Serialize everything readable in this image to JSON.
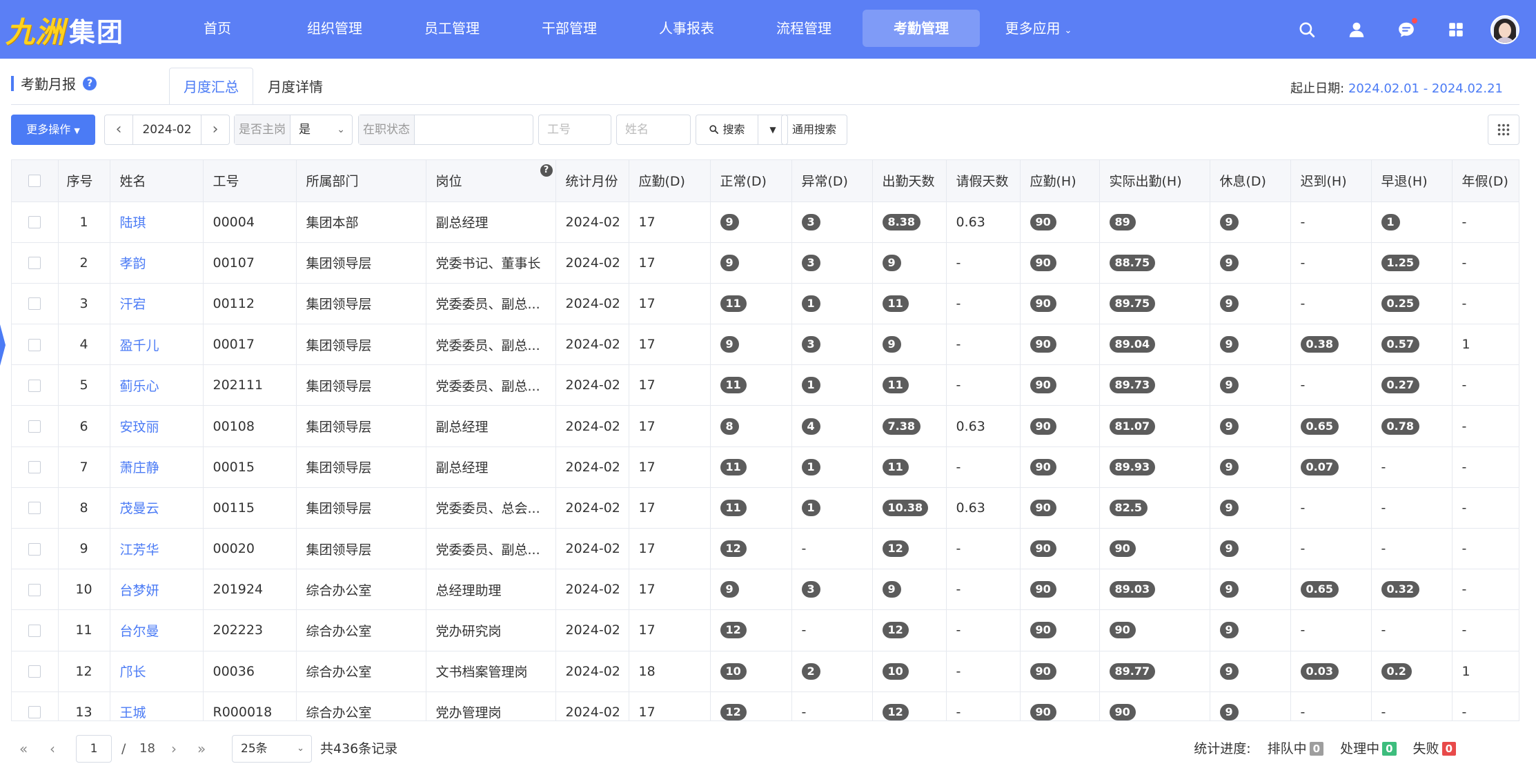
{
  "logo": {
    "part1": "九洲",
    "part2": "集团"
  },
  "nav": {
    "items": [
      {
        "label": "首页"
      },
      {
        "label": "组织管理"
      },
      {
        "label": "员工管理"
      },
      {
        "label": "干部管理"
      },
      {
        "label": "人事报表"
      },
      {
        "label": "流程管理"
      },
      {
        "label": "考勤管理"
      },
      {
        "label": "更多应用"
      }
    ],
    "active": "考勤管理",
    "more_caret": "⌄"
  },
  "header_icons": [
    "search-icon",
    "user-icon",
    "message-icon",
    "apps-icon",
    "avatar"
  ],
  "page": {
    "title": "考勤月报",
    "help": "?"
  },
  "tabs": [
    {
      "label": "月度汇总"
    },
    {
      "label": "月度详情"
    }
  ],
  "date_range": {
    "label": "起止日期:",
    "value": "2024.02.01 - 2024.02.21"
  },
  "toolbar": {
    "more_ops": "更多操作",
    "month": "2024-02",
    "is_main_post": {
      "label": "是否主岗",
      "value": "是"
    },
    "employment_status": {
      "label": "在职状态",
      "value": ""
    },
    "employee_no_placeholder": "工号",
    "name_placeholder": "姓名",
    "search_label": "搜索",
    "general_search_label": "通用搜索"
  },
  "table": {
    "columns": [
      "序号",
      "姓名",
      "工号",
      "所属部门",
      "岗位",
      "统计月份",
      "应勤(D)",
      "正常(D)",
      "异常(D)",
      "出勤天数",
      "请假天数",
      "应勤(H)",
      "实际出勤(H)",
      "休息(D)",
      "迟到(H)",
      "早退(H)",
      "年假(D)"
    ],
    "rows": [
      {
        "no": "1",
        "name": "陆琪",
        "emp_no": "00004",
        "dept": "集团本部",
        "post": "副总经理",
        "month": "2024-02",
        "due_d": "17",
        "normal_d": "9",
        "abnormal_d": "3",
        "attend_days": "8.38",
        "leave_days": "0.63",
        "due_h": "90",
        "actual_h": "89",
        "rest_d": "9",
        "late_h": "-",
        "early_h": "1",
        "annual_d": "-"
      },
      {
        "no": "2",
        "name": "孝韵",
        "emp_no": "00107",
        "dept": "集团领导层",
        "post": "党委书记、董事长",
        "month": "2024-02",
        "due_d": "17",
        "normal_d": "9",
        "abnormal_d": "3",
        "attend_days": "9",
        "leave_days": "-",
        "due_h": "90",
        "actual_h": "88.75",
        "rest_d": "9",
        "late_h": "-",
        "early_h": "1.25",
        "annual_d": "-"
      },
      {
        "no": "3",
        "name": "汗宕",
        "emp_no": "00112",
        "dept": "集团领导层",
        "post": "党委委员、副总...",
        "month": "2024-02",
        "due_d": "17",
        "normal_d": "11",
        "abnormal_d": "1",
        "attend_days": "11",
        "leave_days": "-",
        "due_h": "90",
        "actual_h": "89.75",
        "rest_d": "9",
        "late_h": "-",
        "early_h": "0.25",
        "annual_d": "-"
      },
      {
        "no": "4",
        "name": "盈千儿",
        "emp_no": "00017",
        "dept": "集团领导层",
        "post": "党委委员、副总...",
        "month": "2024-02",
        "due_d": "17",
        "normal_d": "9",
        "abnormal_d": "3",
        "attend_days": "9",
        "leave_days": "-",
        "due_h": "90",
        "actual_h": "89.04",
        "rest_d": "9",
        "late_h": "0.38",
        "early_h": "0.57",
        "annual_d": "1"
      },
      {
        "no": "5",
        "name": "蓟乐心",
        "emp_no": "202111",
        "dept": "集团领导层",
        "post": "党委委员、副总...",
        "month": "2024-02",
        "due_d": "17",
        "normal_d": "11",
        "abnormal_d": "1",
        "attend_days": "11",
        "leave_days": "-",
        "due_h": "90",
        "actual_h": "89.73",
        "rest_d": "9",
        "late_h": "-",
        "early_h": "0.27",
        "annual_d": "-"
      },
      {
        "no": "6",
        "name": "安玟丽",
        "emp_no": "00108",
        "dept": "集团领导层",
        "post": "副总经理",
        "month": "2024-02",
        "due_d": "17",
        "normal_d": "8",
        "abnormal_d": "4",
        "attend_days": "7.38",
        "leave_days": "0.63",
        "due_h": "90",
        "actual_h": "81.07",
        "rest_d": "9",
        "late_h": "0.65",
        "early_h": "0.78",
        "annual_d": "-"
      },
      {
        "no": "7",
        "name": "萧庄静",
        "emp_no": "00015",
        "dept": "集团领导层",
        "post": "副总经理",
        "month": "2024-02",
        "due_d": "17",
        "normal_d": "11",
        "abnormal_d": "1",
        "attend_days": "11",
        "leave_days": "-",
        "due_h": "90",
        "actual_h": "89.93",
        "rest_d": "9",
        "late_h": "0.07",
        "early_h": "-",
        "annual_d": "-"
      },
      {
        "no": "8",
        "name": "茂曼云",
        "emp_no": "00115",
        "dept": "集团领导层",
        "post": "党委委员、总会...",
        "month": "2024-02",
        "due_d": "17",
        "normal_d": "11",
        "abnormal_d": "1",
        "attend_days": "10.38",
        "leave_days": "0.63",
        "due_h": "90",
        "actual_h": "82.5",
        "rest_d": "9",
        "late_h": "-",
        "early_h": "-",
        "annual_d": "-"
      },
      {
        "no": "9",
        "name": "江芳华",
        "emp_no": "00020",
        "dept": "集团领导层",
        "post": "党委委员、副总...",
        "month": "2024-02",
        "due_d": "17",
        "normal_d": "12",
        "abnormal_d": "-",
        "attend_days": "12",
        "leave_days": "-",
        "due_h": "90",
        "actual_h": "90",
        "rest_d": "9",
        "late_h": "-",
        "early_h": "-",
        "annual_d": "-"
      },
      {
        "no": "10",
        "name": "台梦妍",
        "emp_no": "201924",
        "dept": "综合办公室",
        "post": "总经理助理",
        "month": "2024-02",
        "due_d": "17",
        "normal_d": "9",
        "abnormal_d": "3",
        "attend_days": "9",
        "leave_days": "-",
        "due_h": "90",
        "actual_h": "89.03",
        "rest_d": "9",
        "late_h": "0.65",
        "early_h": "0.32",
        "annual_d": "-"
      },
      {
        "no": "11",
        "name": "台尔曼",
        "emp_no": "202223",
        "dept": "综合办公室",
        "post": "党办研究岗",
        "month": "2024-02",
        "due_d": "17",
        "normal_d": "12",
        "abnormal_d": "-",
        "attend_days": "12",
        "leave_days": "-",
        "due_h": "90",
        "actual_h": "90",
        "rest_d": "9",
        "late_h": "-",
        "early_h": "-",
        "annual_d": "-"
      },
      {
        "no": "12",
        "name": "邝长",
        "emp_no": "00036",
        "dept": "综合办公室",
        "post": "文书档案管理岗",
        "month": "2024-02",
        "due_d": "18",
        "normal_d": "10",
        "abnormal_d": "2",
        "attend_days": "10",
        "leave_days": "-",
        "due_h": "90",
        "actual_h": "89.77",
        "rest_d": "9",
        "late_h": "0.03",
        "early_h": "0.2",
        "annual_d": "1"
      },
      {
        "no": "13",
        "name": "王城",
        "emp_no": "R000018",
        "dept": "综合办公室",
        "post": "党办管理岗",
        "month": "2024-02",
        "due_d": "17",
        "normal_d": "12",
        "abnormal_d": "-",
        "attend_days": "12",
        "leave_days": "-",
        "due_h": "90",
        "actual_h": "90",
        "rest_d": "9",
        "late_h": "-",
        "early_h": "-",
        "annual_d": "-"
      }
    ]
  },
  "pagination": {
    "current_page": "1",
    "separator": "/",
    "total_pages": "18",
    "page_size": "25条",
    "total_records": "共436条记录"
  },
  "stats": {
    "label": "统计进度:",
    "queued": {
      "label": "排队中",
      "count": "0",
      "color": "#9e9e9e"
    },
    "processing": {
      "label": "处理中",
      "count": "0",
      "color": "#3dbd7d"
    },
    "failed": {
      "label": "失败",
      "count": "0",
      "color": "#e84a4a"
    }
  }
}
